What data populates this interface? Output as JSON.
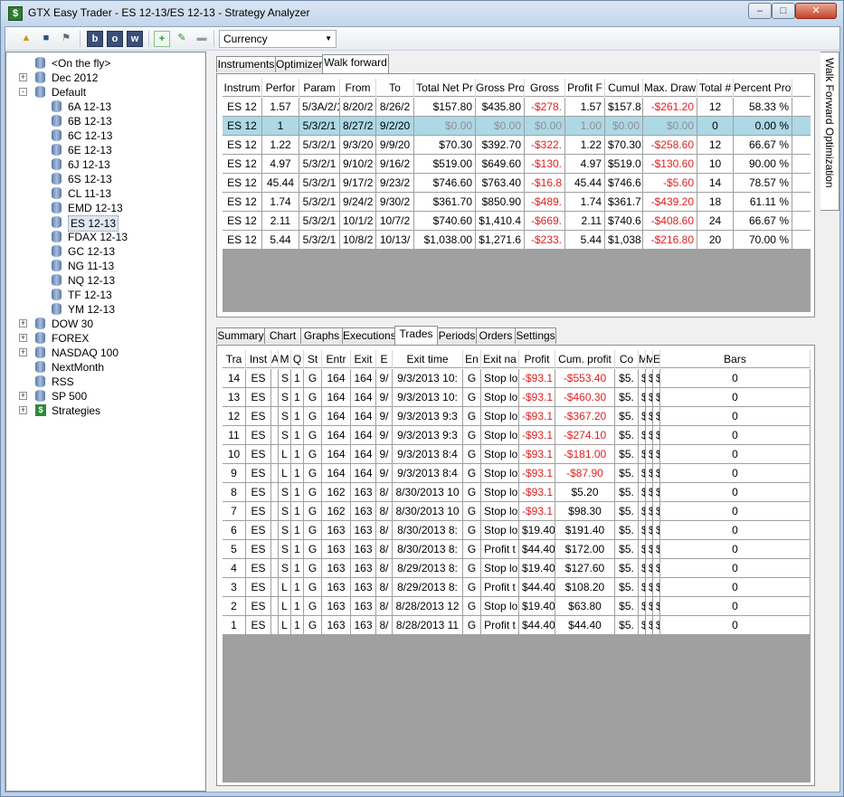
{
  "window": {
    "title": "GTX Easy Trader - ES 12-13/ES 12-13 - Strategy Analyzer"
  },
  "toolbar": {
    "b_label": "b",
    "o_label": "o",
    "w_label": "w",
    "currency_value": "Currency"
  },
  "tree": [
    {
      "label": "<On the fly>",
      "indent": 1,
      "expander": "",
      "icon": "db"
    },
    {
      "label": "Dec 2012",
      "indent": 0,
      "expander": "+",
      "icon": "db"
    },
    {
      "label": "Default",
      "indent": 0,
      "expander": "-",
      "icon": "db"
    },
    {
      "label": "6A 12-13",
      "indent": 2,
      "expander": "",
      "icon": "db"
    },
    {
      "label": "6B 12-13",
      "indent": 2,
      "expander": "",
      "icon": "db"
    },
    {
      "label": "6C 12-13",
      "indent": 2,
      "expander": "",
      "icon": "db"
    },
    {
      "label": "6E 12-13",
      "indent": 2,
      "expander": "",
      "icon": "db"
    },
    {
      "label": "6J 12-13",
      "indent": 2,
      "expander": "",
      "icon": "db"
    },
    {
      "label": "6S 12-13",
      "indent": 2,
      "expander": "",
      "icon": "db"
    },
    {
      "label": "CL 11-13",
      "indent": 2,
      "expander": "",
      "icon": "db"
    },
    {
      "label": "EMD 12-13",
      "indent": 2,
      "expander": "",
      "icon": "db"
    },
    {
      "label": "ES 12-13",
      "indent": 2,
      "expander": "",
      "icon": "db",
      "selected": true
    },
    {
      "label": "FDAX 12-13",
      "indent": 2,
      "expander": "",
      "icon": "db"
    },
    {
      "label": "GC 12-13",
      "indent": 2,
      "expander": "",
      "icon": "db"
    },
    {
      "label": "NG 11-13",
      "indent": 2,
      "expander": "",
      "icon": "db"
    },
    {
      "label": "NQ 12-13",
      "indent": 2,
      "expander": "",
      "icon": "db"
    },
    {
      "label": "TF 12-13",
      "indent": 2,
      "expander": "",
      "icon": "db"
    },
    {
      "label": "YM 12-13",
      "indent": 2,
      "expander": "",
      "icon": "db"
    },
    {
      "label": "DOW 30",
      "indent": 0,
      "expander": "+",
      "icon": "db"
    },
    {
      "label": "FOREX",
      "indent": 0,
      "expander": "+",
      "icon": "db"
    },
    {
      "label": "NASDAQ 100",
      "indent": 0,
      "expander": "+",
      "icon": "db"
    },
    {
      "label": "NextMonth",
      "indent": 1,
      "expander": "",
      "icon": "db"
    },
    {
      "label": "RSS",
      "indent": 1,
      "expander": "",
      "icon": "db"
    },
    {
      "label": "SP 500",
      "indent": 0,
      "expander": "+",
      "icon": "db"
    },
    {
      "label": "Strategies",
      "indent": 0,
      "expander": "+",
      "icon": "strategy"
    }
  ],
  "top_tabs": [
    "Instruments",
    "Optimizer",
    "Walk forward"
  ],
  "top_active": 2,
  "wf_headers": [
    "Instrum",
    "Perfor",
    "Param",
    "From",
    "To",
    "Total Net Pr",
    "Gross Pro",
    "Gross",
    "Profit F",
    "Cumul",
    "Max. Draw",
    "Total #",
    "Percent Prof"
  ],
  "wf_rows": [
    [
      "ES 12",
      "1.57",
      "5/3A/2/1",
      "8/20/2",
      "8/26/2",
      "$157.80",
      "$435.80",
      "-$278.",
      "1.57",
      "$157.8",
      "-$261.20",
      "12",
      "58.33 %"
    ],
    [
      "ES 12",
      "1",
      "5/3/2/1",
      "8/27/2",
      "9/2/20",
      "$0.00",
      "$0.00",
      "$0.00",
      "1.00",
      "$0.00",
      "$0.00",
      "0",
      "0.00 %"
    ],
    [
      "ES 12",
      "1.22",
      "5/3/2/1",
      "9/3/20",
      "9/9/20",
      "$70.30",
      "$392.70",
      "-$322.",
      "1.22",
      "$70.30",
      "-$258.60",
      "12",
      "66.67 %"
    ],
    [
      "ES 12",
      "4.97",
      "5/3/2/1",
      "9/10/2",
      "9/16/2",
      "$519.00",
      "$649.60",
      "-$130.",
      "4.97",
      "$519.0",
      "-$130.60",
      "10",
      "90.00 %"
    ],
    [
      "ES 12",
      "45.44",
      "5/3/2/1",
      "9/17/2",
      "9/23/2",
      "$746.60",
      "$763.40",
      "-$16.8",
      "45.44",
      "$746.6",
      "-$5.60",
      "14",
      "78.57 %"
    ],
    [
      "ES 12",
      "1.74",
      "5/3/2/1",
      "9/24/2",
      "9/30/2",
      "$361.70",
      "$850.90",
      "-$489.",
      "1.74",
      "$361.7",
      "-$439.20",
      "18",
      "61.11 %"
    ],
    [
      "ES 12",
      "2.11",
      "5/3/2/1",
      "10/1/2",
      "10/7/2",
      "$740.60",
      "$1,410.4",
      "-$669.",
      "2.11",
      "$740.6",
      "-$408.60",
      "24",
      "66.67 %"
    ],
    [
      "ES 12",
      "5.44",
      "5/3/2/1",
      "10/8/2",
      "10/13/",
      "$1,038.00",
      "$1,271.6",
      "-$233.",
      "5.44",
      "$1,038",
      "-$216.80",
      "20",
      "70.00 %"
    ]
  ],
  "bottom_tabs": [
    "Summary",
    "Chart",
    "Graphs",
    "Executions",
    "Trades",
    "Periods",
    "Orders",
    "Settings"
  ],
  "bottom_active": 4,
  "tr_headers": [
    "Tra",
    "Inst",
    "A",
    "M",
    "Q",
    "St",
    "Entr",
    "Exit",
    "E",
    "Exit time",
    "En",
    "Exit na",
    "Profit",
    "Cum. profit",
    "Co",
    "M",
    "M",
    "E",
    "Bars"
  ],
  "tr_rows": [
    [
      "14",
      "ES",
      "",
      "S",
      "1",
      "G",
      "164",
      "164",
      "9/",
      "9/3/2013 10:",
      "G",
      "Stop lo",
      "-$93.1",
      "-$553.40",
      "$5.",
      "$",
      "$",
      "$",
      "0"
    ],
    [
      "13",
      "ES",
      "",
      "S",
      "1",
      "G",
      "164",
      "164",
      "9/",
      "9/3/2013 10:",
      "G",
      "Stop lo",
      "-$93.1",
      "-$460.30",
      "$5.",
      "$",
      "$",
      "$",
      "0"
    ],
    [
      "12",
      "ES",
      "",
      "S",
      "1",
      "G",
      "164",
      "164",
      "9/",
      "9/3/2013 9:3",
      "G",
      "Stop lo",
      "-$93.1",
      "-$367.20",
      "$5.",
      "$",
      "$",
      "$",
      "0"
    ],
    [
      "11",
      "ES",
      "",
      "S",
      "1",
      "G",
      "164",
      "164",
      "9/",
      "9/3/2013 9:3",
      "G",
      "Stop lo",
      "-$93.1",
      "-$274.10",
      "$5.",
      "$",
      "$",
      "$",
      "0"
    ],
    [
      "10",
      "ES",
      "",
      "L",
      "1",
      "G",
      "164",
      "164",
      "9/",
      "9/3/2013 8:4",
      "G",
      "Stop lo",
      "-$93.1",
      "-$181.00",
      "$5.",
      "$",
      "$",
      "$",
      "0"
    ],
    [
      "9",
      "ES",
      "",
      "L",
      "1",
      "G",
      "164",
      "164",
      "9/",
      "9/3/2013 8:4",
      "G",
      "Stop lo",
      "-$93.1",
      "-$87.90",
      "$5.",
      "$",
      "$",
      "$",
      "0"
    ],
    [
      "8",
      "ES",
      "",
      "S",
      "1",
      "G",
      "162",
      "163",
      "8/",
      "8/30/2013 10",
      "G",
      "Stop lo",
      "-$93.1",
      "$5.20",
      "$5.",
      "$",
      "$",
      "$",
      "0"
    ],
    [
      "7",
      "ES",
      "",
      "S",
      "1",
      "G",
      "162",
      "163",
      "8/",
      "8/30/2013 10",
      "G",
      "Stop lo",
      "-$93.1",
      "$98.30",
      "$5.",
      "$",
      "$",
      "$",
      "0"
    ],
    [
      "6",
      "ES",
      "",
      "S",
      "1",
      "G",
      "163",
      "163",
      "8/",
      "8/30/2013 8:",
      "G",
      "Stop lo",
      "$19.40",
      "$191.40",
      "$5.",
      "$",
      "$",
      "$",
      "0"
    ],
    [
      "5",
      "ES",
      "",
      "S",
      "1",
      "G",
      "163",
      "163",
      "8/",
      "8/30/2013 8:",
      "G",
      "Profit t",
      "$44.40",
      "$172.00",
      "$5.",
      "$",
      "$",
      "$",
      "0"
    ],
    [
      "4",
      "ES",
      "",
      "S",
      "1",
      "G",
      "163",
      "163",
      "8/",
      "8/29/2013 8:",
      "G",
      "Stop lo",
      "$19.40",
      "$127.60",
      "$5.",
      "$",
      "$",
      "$",
      "0"
    ],
    [
      "3",
      "ES",
      "",
      "L",
      "1",
      "G",
      "163",
      "163",
      "8/",
      "8/29/2013 8:",
      "G",
      "Profit t",
      "$44.40",
      "$108.20",
      "$5.",
      "$",
      "$",
      "$",
      "0"
    ],
    [
      "2",
      "ES",
      "",
      "L",
      "1",
      "G",
      "163",
      "163",
      "8/",
      "8/28/2013 12",
      "G",
      "Stop lo",
      "$19.40",
      "$63.80",
      "$5.",
      "$",
      "$",
      "$",
      "0"
    ],
    [
      "1",
      "ES",
      "",
      "L",
      "1",
      "G",
      "163",
      "163",
      "8/",
      "8/28/2013 11",
      "G",
      "Profit t",
      "$44.40",
      "$44.40",
      "$5.",
      "$",
      "$",
      "$",
      "0"
    ]
  ],
  "side_tab": "Walk Forward Optimization",
  "colors": {
    "negative": "#e02020",
    "selection": "#add8e6",
    "grid_empty": "#a0a0a0"
  }
}
